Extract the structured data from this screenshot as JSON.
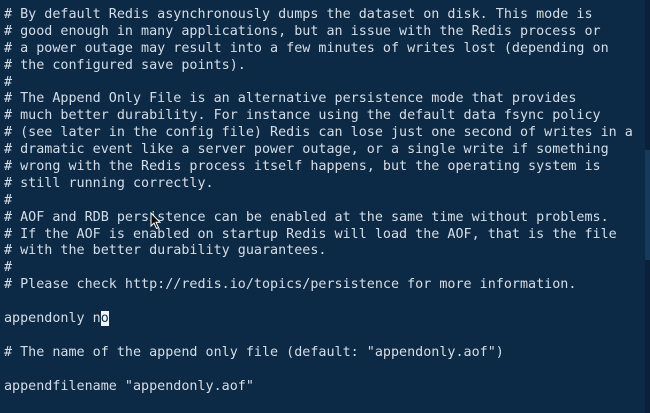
{
  "terminal": {
    "lines": [
      "# By default Redis asynchronously dumps the dataset on disk. This mode is",
      "# good enough in many applications, but an issue with the Redis process or",
      "# a power outage may result into a few minutes of writes lost (depending on",
      "# the configured save points).",
      "#",
      "# The Append Only File is an alternative persistence mode that provides",
      "# much better durability. For instance using the default data fsync policy",
      "# (see later in the config file) Redis can lose just one second of writes in a",
      "# dramatic event like a server power outage, or a single write if something",
      "# wrong with the Redis process itself happens, but the operating system is",
      "# still running correctly.",
      "#",
      "# AOF and RDB persistence can be enabled at the same time without problems.",
      "# If the AOF is enabled on startup Redis will load the AOF, that is the file",
      "# with the better durability guarantees.",
      "#",
      "# Please check http://redis.io/topics/persistence for more information.",
      ""
    ],
    "cursor_line": {
      "before": "appendonly n",
      "cursor_char": "o",
      "after": ""
    },
    "lines_after": [
      "",
      "# The name of the append only file (default: \"appendonly.aof\")",
      "",
      "appendfilename \"appendonly.aof\""
    ],
    "cursor_icon": "mouse-pointer-icon"
  }
}
